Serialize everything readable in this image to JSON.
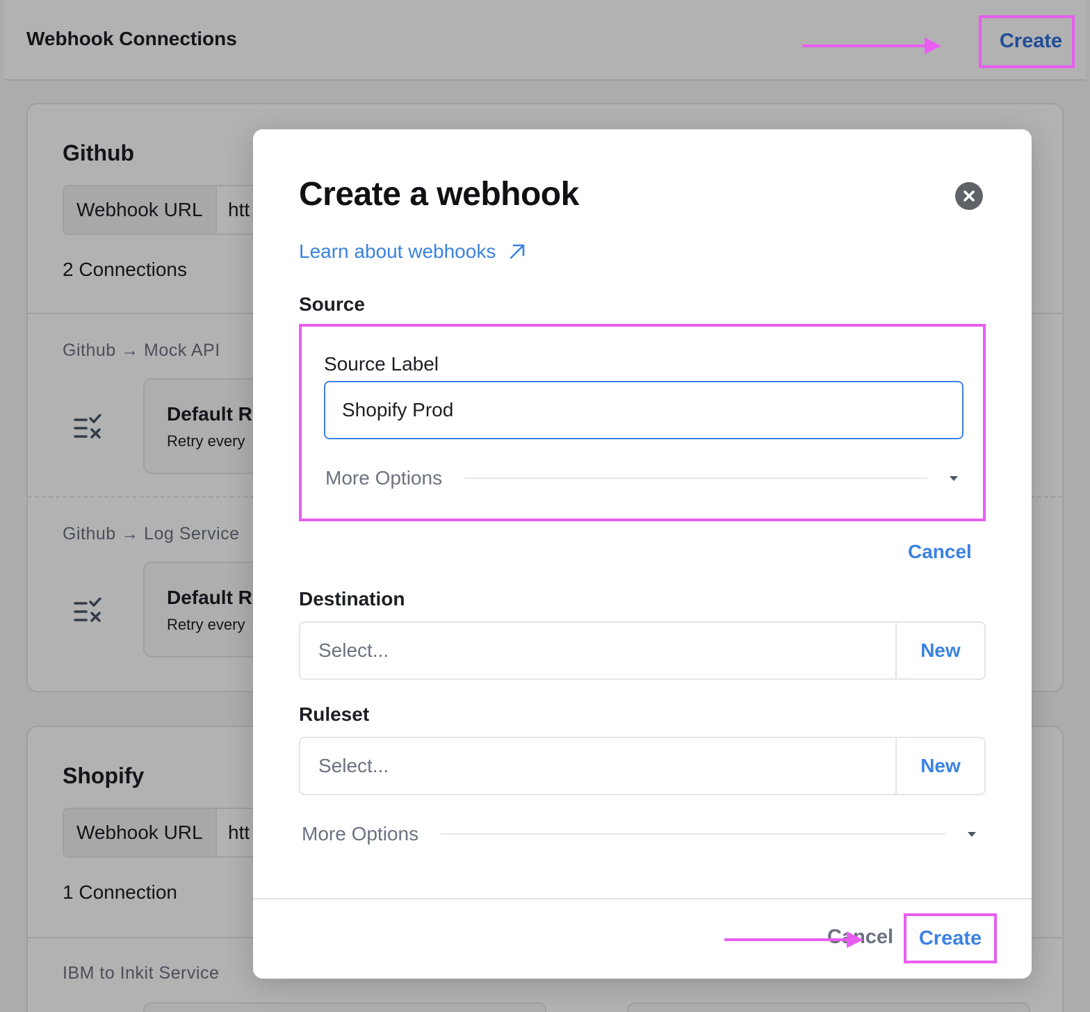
{
  "header": {
    "title": "Webhook Connections",
    "create_label": "Create"
  },
  "sources": [
    {
      "name": "Github",
      "url_label": "Webhook URL",
      "url_value": "htt",
      "count": "2 Connections",
      "connections": [
        {
          "route": "Github → Mock API",
          "rule_title": "Default R",
          "rule_sub": "Retry every"
        },
        {
          "route": "Github → Log Service",
          "rule_title": "Default R",
          "rule_sub": "Retry every"
        }
      ]
    },
    {
      "name": "Shopify",
      "url_label": "Webhook URL",
      "url_value": "htt",
      "count": "1 Connection",
      "connections": [
        {
          "route": "IBM to Inkit Service"
        }
      ]
    }
  ],
  "modal": {
    "title": "Create a webhook",
    "learn_link": "Learn about webhooks",
    "source": {
      "section_label": "Source",
      "field_label": "Source Label",
      "field_value": "Shopify Prod",
      "more_options": "More Options",
      "cancel": "Cancel"
    },
    "destination": {
      "section_label": "Destination",
      "placeholder": "Select...",
      "new_label": "New"
    },
    "ruleset": {
      "section_label": "Ruleset",
      "placeholder": "Select...",
      "new_label": "New"
    },
    "more_options": "More Options",
    "footer": {
      "cancel": "Cancel",
      "create": "Create"
    }
  },
  "colors": {
    "accent": "#3b82e0",
    "highlight": "#e85ef0",
    "overlay": "rgba(0,0,0,0.30)"
  },
  "icons": [
    "close-icon",
    "external-link-arrow-icon",
    "ruleset-icon",
    "caret-down-icon"
  ]
}
